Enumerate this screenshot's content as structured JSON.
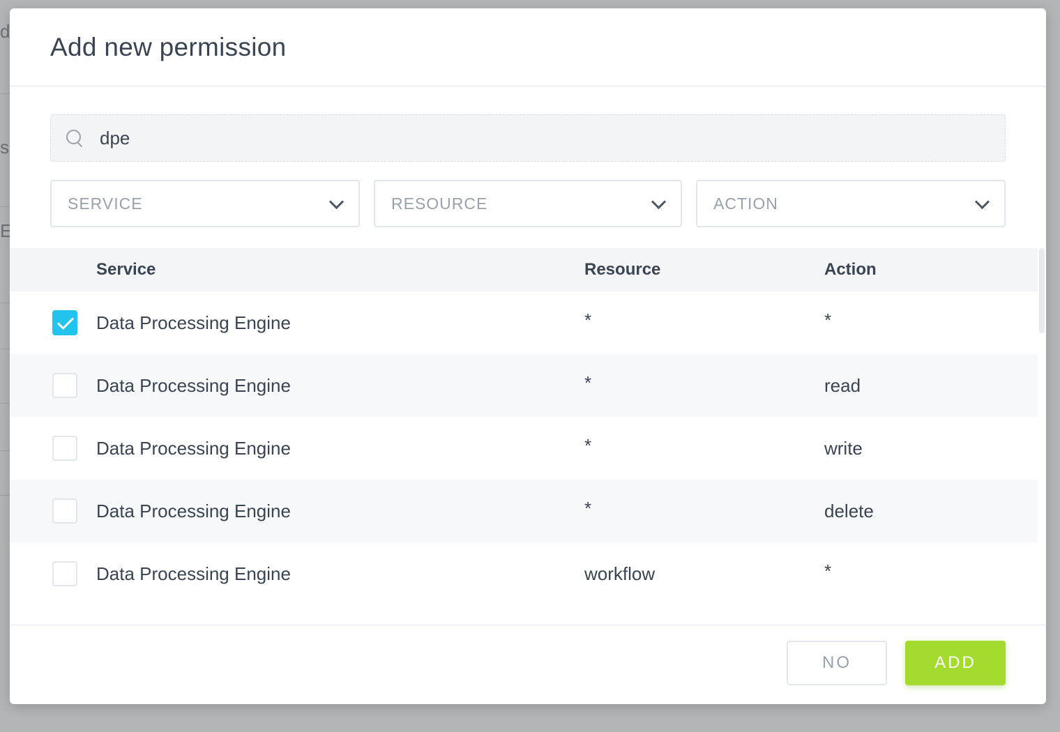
{
  "modal": {
    "title": "Add new permission"
  },
  "search": {
    "value": "dpe",
    "icon": "search-icon"
  },
  "filters": [
    {
      "label": "SERVICE",
      "icon": "chevron-down-icon"
    },
    {
      "label": "RESOURCE",
      "icon": "chevron-down-icon"
    },
    {
      "label": "ACTION",
      "icon": "chevron-down-icon"
    }
  ],
  "table": {
    "headers": {
      "service": "Service",
      "resource": "Resource",
      "action": "Action"
    },
    "rows": [
      {
        "checked": true,
        "service": "Data Processing Engine",
        "resource": "*",
        "action": "*"
      },
      {
        "checked": false,
        "service": "Data Processing Engine",
        "resource": "*",
        "action": "read"
      },
      {
        "checked": false,
        "service": "Data Processing Engine",
        "resource": "*",
        "action": "write"
      },
      {
        "checked": false,
        "service": "Data Processing Engine",
        "resource": "*",
        "action": "delete"
      },
      {
        "checked": false,
        "service": "Data Processing Engine",
        "resource": "workflow",
        "action": "*"
      }
    ]
  },
  "footer": {
    "no_label": "NO",
    "add_label": "ADD"
  },
  "colors": {
    "accent_check": "#22c4ee",
    "add_button": "#a3dc2e",
    "overlay": "#a9abad"
  }
}
